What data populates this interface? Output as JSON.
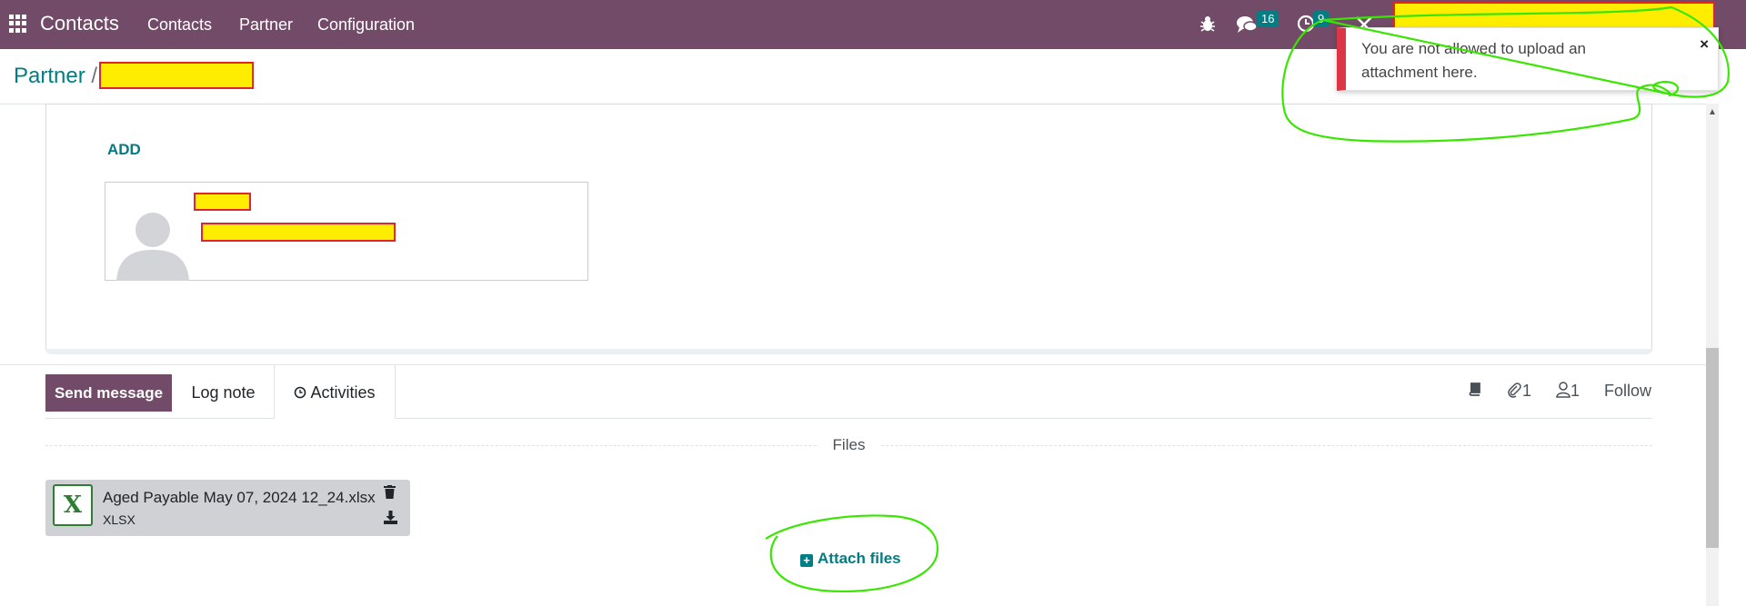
{
  "navbar": {
    "app_name": "Contacts",
    "menu": [
      "Contacts",
      "Partner",
      "Configuration"
    ],
    "messages_count": "16",
    "activities_count": "9",
    "icons": [
      "apps-grid-icon",
      "bug-icon",
      "chat-icon",
      "clock-icon",
      "tools-icon"
    ]
  },
  "breadcrumb": {
    "parent": "Partner",
    "separator": "/"
  },
  "form": {
    "add_label": "ADD"
  },
  "chatter": {
    "send_message": "Send message",
    "log_note": "Log note",
    "activities": "Activities",
    "attachments_count": "1",
    "followers_count": "1",
    "follow": "Follow",
    "files_title": "Files",
    "attachment": {
      "name": "Aged Payable May 07, 2024 12_24.xlsx",
      "ext": "XLSX",
      "icon_letter": "X"
    },
    "attach_files": "Attach files"
  },
  "toast": {
    "message": "You are not allowed to upload an attachment here.",
    "close": "×"
  },
  "colors": {
    "brand": "#714b67",
    "accent": "#017e84",
    "danger": "#dc3545",
    "redaction": "#ffed00",
    "annotation": "#39e600"
  }
}
